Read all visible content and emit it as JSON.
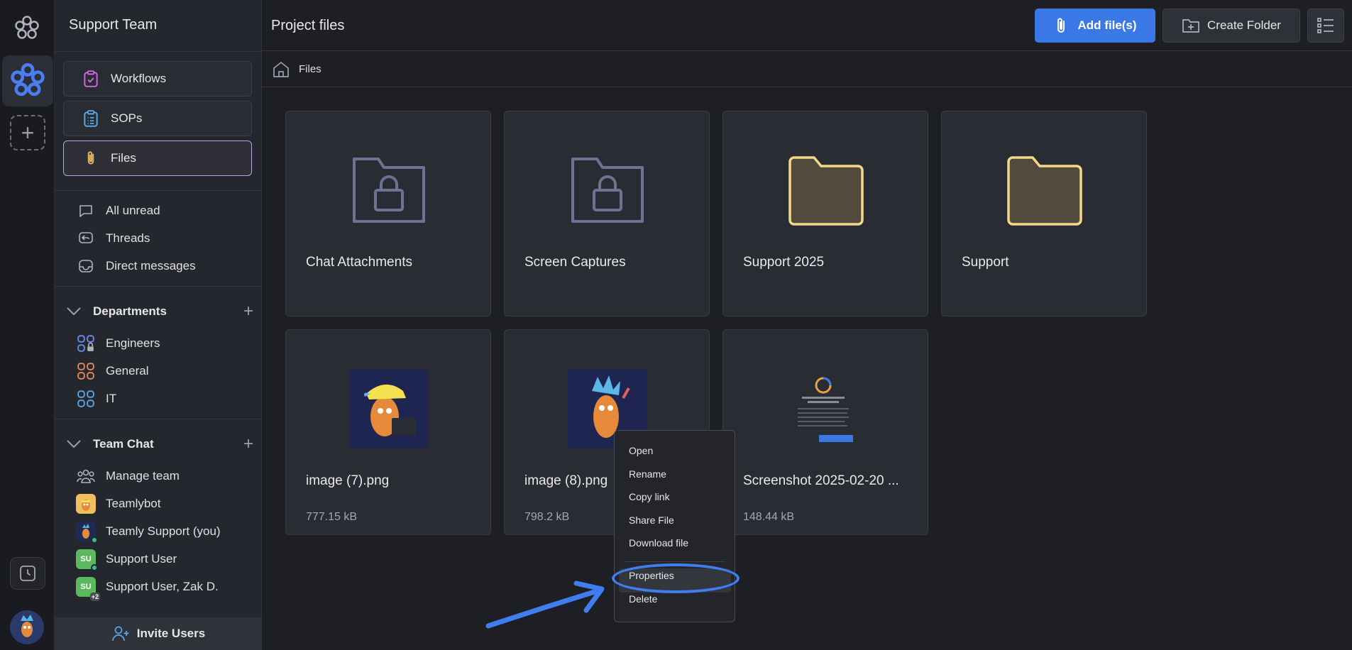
{
  "sidebar": {
    "team_name": "Support Team",
    "nav": [
      {
        "label": "Workflows",
        "icon": "clipboard-check-icon"
      },
      {
        "label": "SOPs",
        "icon": "clipboard-list-icon"
      },
      {
        "label": "Files",
        "icon": "paperclip-icon"
      }
    ],
    "quick": [
      {
        "label": "All unread",
        "icon": "chat-bubble-icon"
      },
      {
        "label": "Threads",
        "icon": "threads-icon"
      },
      {
        "label": "Direct messages",
        "icon": "inbox-icon"
      }
    ],
    "departments": {
      "title": "Departments",
      "items": [
        {
          "label": "Engineers",
          "color": "#6b8cf0"
        },
        {
          "label": "General",
          "color": "#e88a5a"
        },
        {
          "label": "IT",
          "color": "#5aa8e8"
        }
      ]
    },
    "team_chat": {
      "title": "Team Chat",
      "items": [
        {
          "label": "Manage team",
          "icon": "users-icon"
        },
        {
          "label": "Teamlybot",
          "icon": "bot-avatar"
        },
        {
          "label": "Teamly Support (you)",
          "icon": "user-avatar"
        },
        {
          "label": "Support User",
          "initials": "SU"
        },
        {
          "label": "Support User, Zak D.",
          "initials": "SU",
          "extra": "+2"
        }
      ]
    },
    "invite_label": "Invite Users"
  },
  "header": {
    "title": "Project files",
    "add_label": "Add file(s)",
    "folder_label": "Create Folder"
  },
  "breadcrumb": {
    "current": "Files"
  },
  "folders": [
    {
      "name": "Chat Attachments",
      "locked": true
    },
    {
      "name": "Screen Captures",
      "locked": true
    },
    {
      "name": "Support 2025",
      "locked": false
    },
    {
      "name": "Support",
      "locked": false
    }
  ],
  "files": [
    {
      "name": "image (7).png",
      "size": "777.15 kB"
    },
    {
      "name": "image (8).png",
      "size": "798.2 kB"
    },
    {
      "name": "Screenshot 2025-02-20 ...",
      "size": "148.44 kB"
    }
  ],
  "context_menu": {
    "items": [
      "Open",
      "Rename",
      "Copy link",
      "Share File",
      "Download file",
      "Properties",
      "Delete"
    ],
    "highlighted": "Properties"
  },
  "colors": {
    "accent": "#3a78e6",
    "annotation": "#3f7ef0",
    "folder_yellow": "#f2d98a"
  }
}
